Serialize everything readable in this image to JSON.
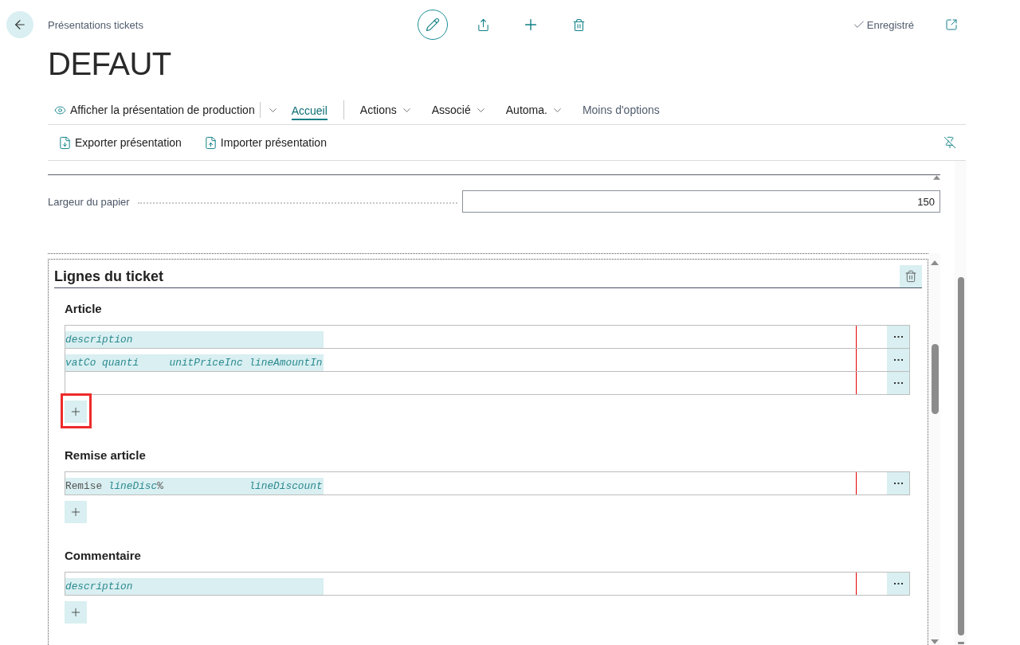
{
  "header": {
    "breadcrumb": "Présentations tickets",
    "status": "Enregistré"
  },
  "title": "DEFAUT",
  "action_bar": {
    "primary_action": "Afficher la présentation de production",
    "tabs": [
      {
        "label": "Accueil",
        "selected": true
      }
    ],
    "menus": [
      "Actions",
      "Associé",
      "Automa."
    ],
    "toggle_link": "Moins d'options"
  },
  "toolbar": {
    "actions": [
      {
        "label": "Exporter présentation",
        "kind": "export"
      },
      {
        "label": "Importer présentation",
        "kind": "import"
      }
    ]
  },
  "paper": {
    "fields": [
      {
        "label": "Largeur du papier",
        "value": "150"
      }
    ]
  },
  "ticket_lines": {
    "title": "Lignes du ticket",
    "groups": [
      {
        "title": "Article",
        "rows": [
          {
            "blank": false,
            "segments": [
              {
                "kind": "field",
                "text": "description"
              }
            ]
          },
          {
            "blank": false,
            "segments": [
              {
                "kind": "field",
                "text": "vatCo quanti     unitPriceInc lineAmountIn"
              }
            ]
          },
          {
            "blank": true
          }
        ],
        "add_button_callout": {
          "kind": "box"
        }
      },
      {
        "title": "Remise article",
        "rows": [
          {
            "blank": false,
            "segments": [
              {
                "kind": "literal",
                "text": "Remise "
              },
              {
                "kind": "field",
                "text": "lineDisc"
              },
              {
                "kind": "literal",
                "text": "%              "
              },
              {
                "kind": "field",
                "text": "lineDiscount"
              }
            ]
          }
        ]
      },
      {
        "title": "Commentaire",
        "rows": [
          {
            "blank": false,
            "segments": [
              {
                "kind": "field",
                "text": "description"
              }
            ]
          }
        ]
      }
    ]
  }
}
